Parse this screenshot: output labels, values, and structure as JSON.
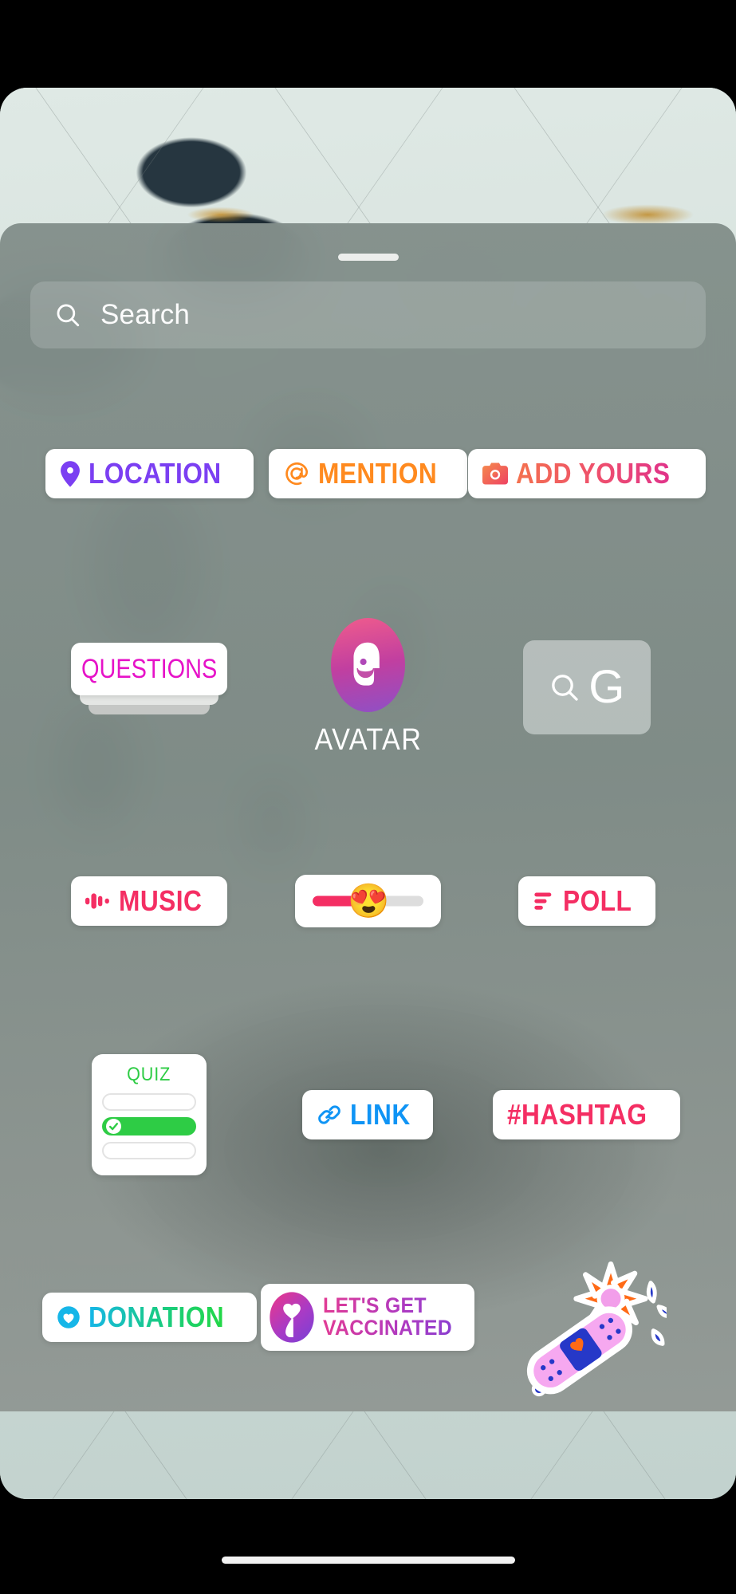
{
  "app": {
    "screen_name": "Instagram Stories sticker tray"
  },
  "drawer": {
    "grabber": "drag-handle"
  },
  "search": {
    "placeholder": "Search",
    "icon": "search-icon"
  },
  "gif_button": {
    "label": "G",
    "icon": "search-icon",
    "name": "gif-search-button"
  },
  "avatar": {
    "label": "AVATAR"
  },
  "quiz": {
    "title": "QUIZ",
    "options": [
      "",
      "",
      ""
    ],
    "correct_index": 1
  },
  "slider": {
    "emoji": "😍",
    "fill_percent": 50
  },
  "vaccinated": {
    "line1": "LET'S GET",
    "line2": "VACCINATED"
  },
  "stickers": {
    "location": {
      "label": "LOCATION",
      "icon": "map-pin-icon",
      "color": "#7B3FF2"
    },
    "mention": {
      "label": "MENTION",
      "icon": "at-sign-icon",
      "color": "#FF8A1F"
    },
    "add_yours": {
      "label": "ADD YOURS",
      "icon": "camera-icon",
      "color_start": "#F4714E",
      "color_end": "#E0338A"
    },
    "questions": {
      "label": "QUESTIONS",
      "color": "#E612C8"
    },
    "music": {
      "label": "MUSIC",
      "icon": "music-bars-icon",
      "color": "#F42E63"
    },
    "poll": {
      "label": "POLL",
      "icon": "poll-bars-icon",
      "color": "#F42E63"
    },
    "link": {
      "label": "LINK",
      "icon": "link-chain-icon",
      "color": "#0F94F5"
    },
    "hashtag": {
      "label": "#HASHTAG",
      "color": "#F42E63"
    },
    "donation": {
      "label": "DONATION",
      "icon": "heart-badge-icon",
      "color_start": "#16B6E8",
      "color_end": "#22D845"
    },
    "flower_bandage": {
      "name": "flower-bandage-sticker"
    }
  },
  "theme": {
    "drawer_bg": "#838f8b",
    "sticker_card_bg": "#ffffff",
    "grabber": "#eceeec"
  }
}
